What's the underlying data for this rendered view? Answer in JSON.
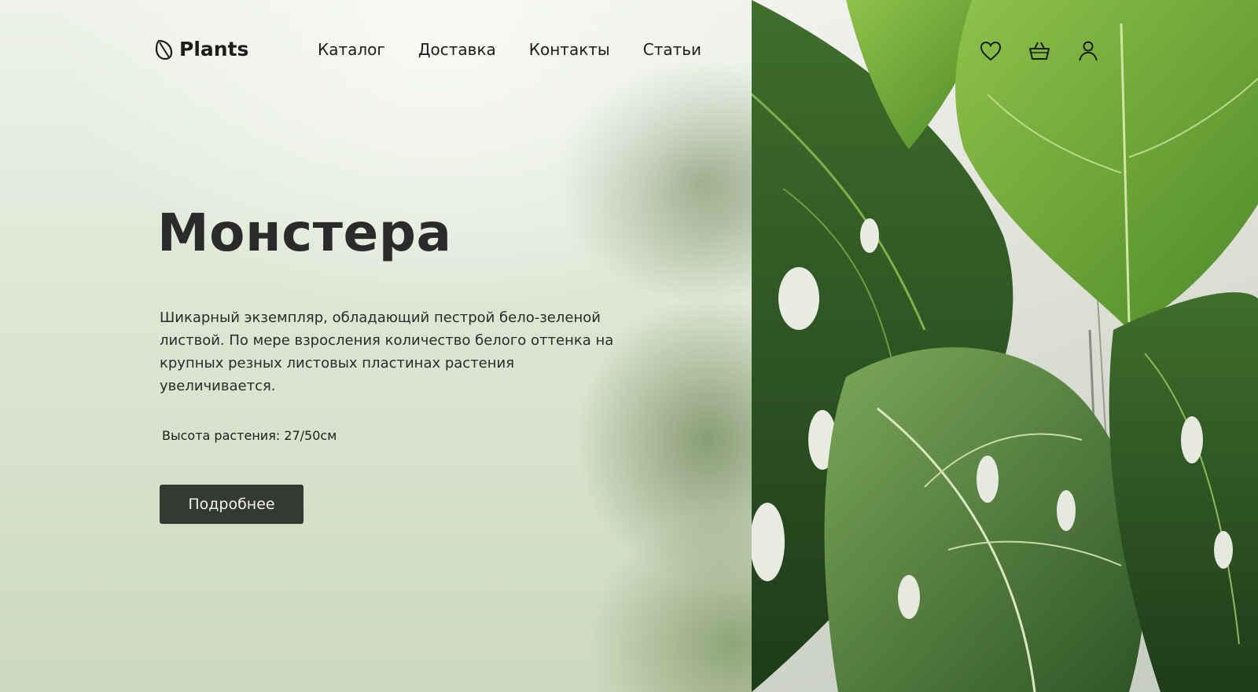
{
  "header": {
    "logo_text": "Plants",
    "nav": [
      "Каталог",
      "Доставка",
      "Контакты",
      "Статьи"
    ],
    "icons": [
      "heart-icon",
      "basket-icon",
      "user-icon"
    ]
  },
  "hero": {
    "title": "Монстера",
    "description": "Шикарный экземпляр, обладающий пестрой бело-зеленой листвой. По мере взросления количество белого оттенка на крупных резных листовых пластинах растения увеличивается.",
    "height_label": "Высота растения: 27/50см",
    "cta_label": "Подробнее"
  },
  "colors": {
    "button_bg": "#343a33",
    "text": "#1f1f1f",
    "leaf_green": "#5f8d2f"
  }
}
